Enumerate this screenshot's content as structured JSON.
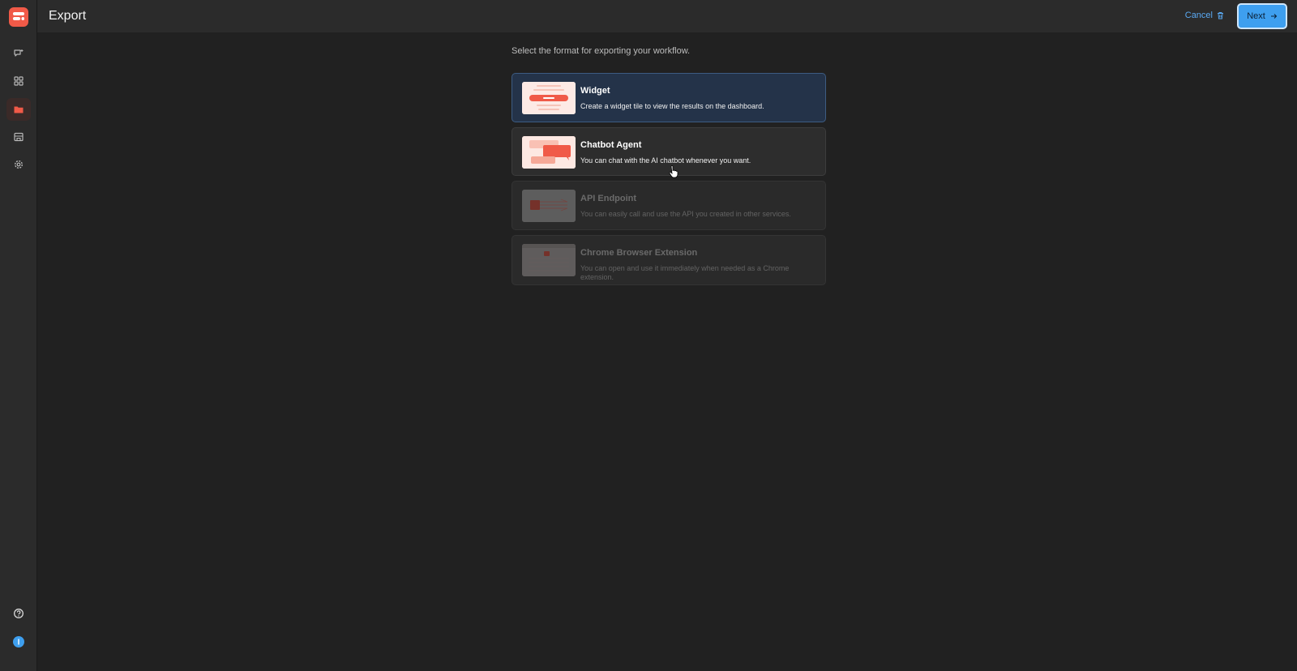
{
  "header": {
    "title": "Export",
    "cancel_label": "Cancel",
    "next_label": "Next"
  },
  "main": {
    "instruction": "Select the format for exporting your workflow.",
    "options": [
      {
        "title": "Widget",
        "description": "Create a widget tile to view the results on the dashboard.",
        "state": "selected"
      },
      {
        "title": "Chatbot Agent",
        "description": "You can chat with the AI chatbot whenever you want.",
        "state": "enabled"
      },
      {
        "title": "API Endpoint",
        "description": "You can easily call and use the API you created in other services.",
        "state": "disabled"
      },
      {
        "title": "Chrome Browser Extension",
        "description": "You can open and use it immediately when needed as a Chrome extension.",
        "state": "disabled"
      }
    ]
  },
  "sidebar": {
    "items": [
      {
        "icon": "chat-plus-icon"
      },
      {
        "icon": "grid-icon"
      },
      {
        "icon": "folder-icon",
        "active": true
      },
      {
        "icon": "store-icon"
      },
      {
        "icon": "gear-icon"
      }
    ],
    "bottom": [
      {
        "icon": "help-icon"
      },
      {
        "icon": "info-icon"
      }
    ]
  },
  "colors": {
    "accent": "#3e9fef",
    "brand": "#f05a48",
    "selected_card": "#243349",
    "background": "#212121"
  }
}
